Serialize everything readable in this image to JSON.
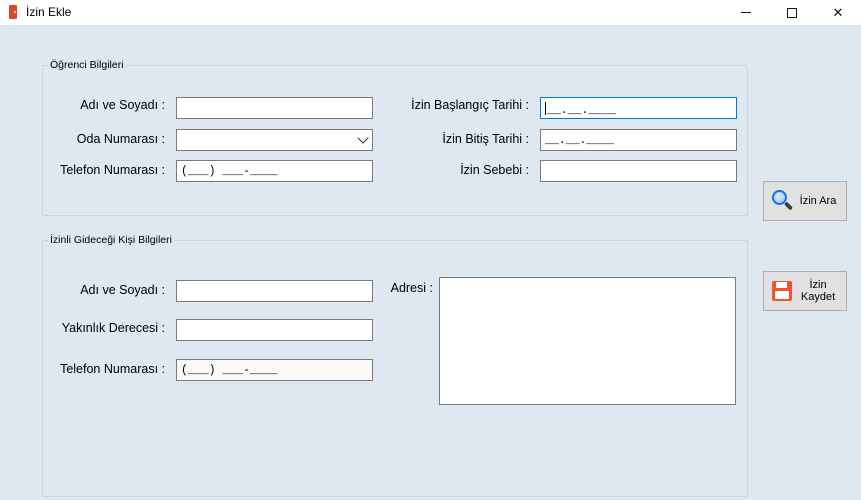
{
  "window": {
    "title": "İzin Ekle",
    "controls": {
      "minimize": "minimize",
      "maximize": "maximize",
      "close": "✕"
    }
  },
  "student_group": {
    "title": "Öğrenci Bilgileri",
    "name_label": "Adı ve Soyadı :",
    "name_value": "",
    "room_label": "Oda Numarası :",
    "room_value": "",
    "phone_label": "Telefon Numarası :",
    "phone_value": "(___) ___-____",
    "start_date_label": "İzin Başlangıç Tarihi :",
    "start_date_value": "__.__.____",
    "end_date_label": "İzin Bitiş Tarihi :",
    "end_date_value": "__.__.____",
    "reason_label": "İzin Sebebi :",
    "reason_value": ""
  },
  "guardian_group": {
    "title": "İzinli Gideceği Kişi Bilgileri",
    "name_label": "Adı ve Soyadı :",
    "name_value": "",
    "relation_label": "Yakınlık Derecesi :",
    "relation_value": "",
    "phone_label": "Telefon Numarası :",
    "phone_value": "(___) ___-____",
    "address_label": "Adresi :",
    "address_value": ""
  },
  "buttons": {
    "search_label": "İzin Ara",
    "save_label_line1": "İzin",
    "save_label_line2": "Kaydet"
  },
  "colors": {
    "client_bg": "#dfe7f1",
    "focus_border": "#0078d7",
    "save_icon": "#f0532d",
    "search_icon": "#1e6fd9"
  }
}
